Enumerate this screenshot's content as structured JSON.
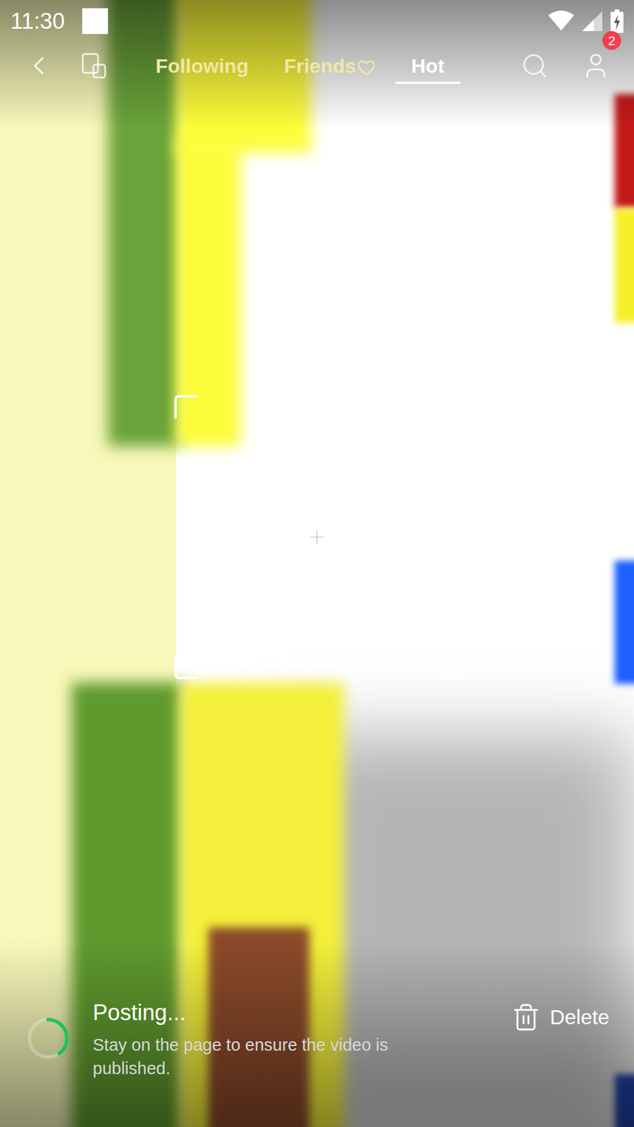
{
  "status_bar": {
    "time": "11:30"
  },
  "nav": {
    "tabs": [
      {
        "label": "Following",
        "selected": false
      },
      {
        "label": "Friends",
        "selected": false
      },
      {
        "label": "Hot",
        "selected": true
      }
    ],
    "profile_badge": "2"
  },
  "upload": {
    "title": "Posting...",
    "message": "Stay on the page to ensure the video is published.",
    "level": 0.4,
    "delete_label": "Delete"
  }
}
